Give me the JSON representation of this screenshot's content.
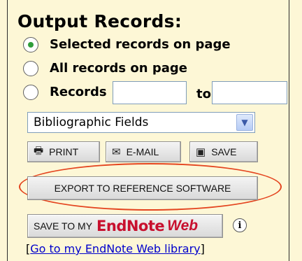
{
  "title": "Output Records:",
  "options": [
    {
      "label": "Selected records on page",
      "checked": true
    },
    {
      "label": "All records on page",
      "checked": false
    },
    {
      "label": "Records",
      "checked": false
    }
  ],
  "range": {
    "to_label": "to",
    "from_value": "",
    "to_value": ""
  },
  "fields_select": {
    "value": "Bibliographic Fields"
  },
  "buttons": {
    "print": "PRINT",
    "email": "E-MAIL",
    "save": "SAVE",
    "export": "EXPORT TO REFERENCE SOFTWARE",
    "save_to_my": "SAVE TO MY",
    "endnote_brand": "EndNote",
    "endnote_web": "Web"
  },
  "info_glyph": "i",
  "link": {
    "open_bracket": "[",
    "text": "Go to my EndNote Web library",
    "close_bracket": "]"
  }
}
